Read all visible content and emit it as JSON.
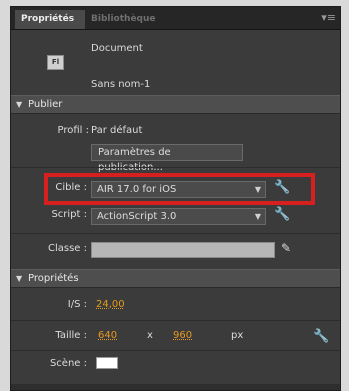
{
  "tabs": {
    "active": "Propriétés",
    "inactive": "Bibliothèque",
    "menu_icon": "panel-menu-icon"
  },
  "document": {
    "type": "Document",
    "name": "Sans nom-1",
    "icon_text": "Fl"
  },
  "publish": {
    "header": "Publier",
    "profile_label": "Profil :",
    "profile_value": "Par défaut",
    "settings_button": "Paramètres de publication...",
    "target_label": "Cible :",
    "target_value": "AIR 17.0 for iOS",
    "script_label": "Script :",
    "script_value": "ActionScript 3.0",
    "class_label": "Classe :"
  },
  "properties": {
    "header": "Propriétés",
    "fps_label": "I/S :",
    "fps_value": "24,00",
    "size_label": "Taille :",
    "width_value": "640",
    "times": "x",
    "height_value": "960",
    "unit": "px",
    "stage_label": "Scène :",
    "stage_color": "#ffffff"
  },
  "colors": {
    "highlight": "#d61f1f",
    "value_accent": "#e79a1d"
  }
}
